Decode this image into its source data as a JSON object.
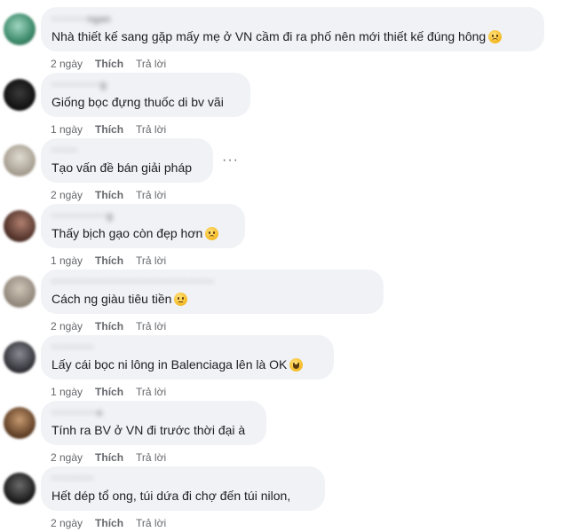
{
  "actions": {
    "like": "Thích",
    "reply": "Trả lời"
  },
  "more_icon": "more-horizontal-icon",
  "comments": [
    {
      "name": "···········ngan",
      "text": "Nhà thiết kế sang gặp mấy mẹ ở VN cầm đi ra phố nên mới thiết kế đúng hông",
      "emoji": "slightly-frowning-face",
      "time": "2 ngày",
      "avatar_color": "#3d8a6a"
    },
    {
      "name": "···············g",
      "text": "Giống bọc đựng thuốc di bv vãi",
      "emoji": "",
      "time": "1 ngày",
      "avatar_color": "#1a1a1a"
    },
    {
      "name": "········",
      "text": "Tạo vấn đề bán giải pháp",
      "emoji": "",
      "time": "2 ngày",
      "avatar_color": "#b5aea0"
    },
    {
      "name": "·················g",
      "text": "Thấy bịch gạo còn đẹp hơn",
      "emoji": "worried-face",
      "time": "1 ngày",
      "avatar_color": "#5a3a30"
    },
    {
      "name": "··················································",
      "text": "Cách ng giàu tiêu tiền",
      "emoji": "face-with-rolling-eyes",
      "time": "2 ngày",
      "avatar_color": "#a89e92"
    },
    {
      "name": "·············",
      "text": "Lấy cái bọc ni lông in Balenciaga lên là OK",
      "emoji": "grinning-squinting-face",
      "time": "1 ngày",
      "avatar_color": "#4a4a52"
    },
    {
      "name": "··············e",
      "text": "Tính ra BV ở VN đi trước thời đại à",
      "emoji": "",
      "time": "2 ngày",
      "avatar_color": "#7a5a3a"
    },
    {
      "name": "·············",
      "text": "Hết dép tổ ong, túi dứa đi chợ đến túi nilon,",
      "emoji": "",
      "time": "2 ngày",
      "avatar_color": "#2a2a2a"
    }
  ]
}
